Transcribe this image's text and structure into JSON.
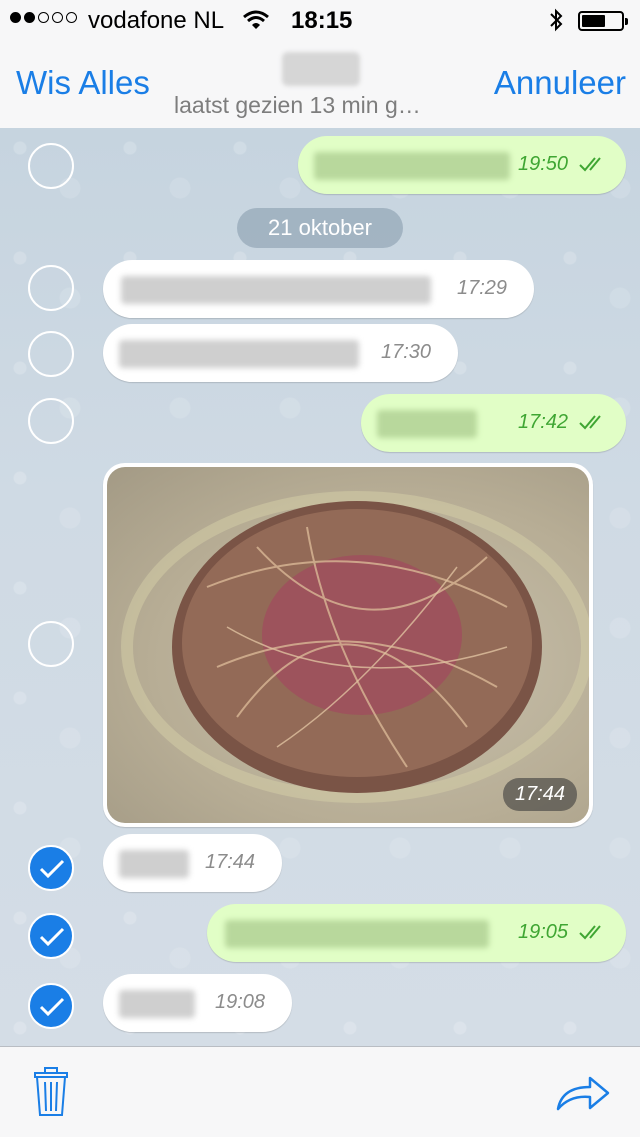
{
  "status_bar": {
    "carrier": "vodafone NL",
    "time": "18:15",
    "signal_bars": 2,
    "battery_level": 0.6
  },
  "nav": {
    "left_label": "Wis Alles",
    "right_label": "Annuleer",
    "subtitle": "laatst gezien 13 min g…"
  },
  "chat": {
    "date_label": "21 oktober",
    "messages": [
      {
        "direction": "out",
        "time": "19:50",
        "selected": false,
        "status": "read"
      },
      {
        "direction": "in",
        "time": "17:29",
        "selected": false
      },
      {
        "direction": "in",
        "time": "17:30",
        "selected": false
      },
      {
        "direction": "out",
        "time": "17:42",
        "selected": false,
        "status": "read"
      },
      {
        "direction": "in",
        "type": "photo",
        "time": "17:44",
        "selected": false
      },
      {
        "direction": "in",
        "time": "17:44",
        "selected": true
      },
      {
        "direction": "out",
        "time": "19:05",
        "selected": true,
        "status": "read"
      },
      {
        "direction": "in",
        "time": "19:08",
        "selected": true
      }
    ]
  },
  "toolbar": {
    "left_icon": "trash-icon",
    "right_icon": "share-icon"
  },
  "colors": {
    "accent": "#1a7ee6",
    "outgoing_bubble": "#e1fec6",
    "incoming_bubble": "#ffffff",
    "read_ticks": "#3fa633"
  }
}
